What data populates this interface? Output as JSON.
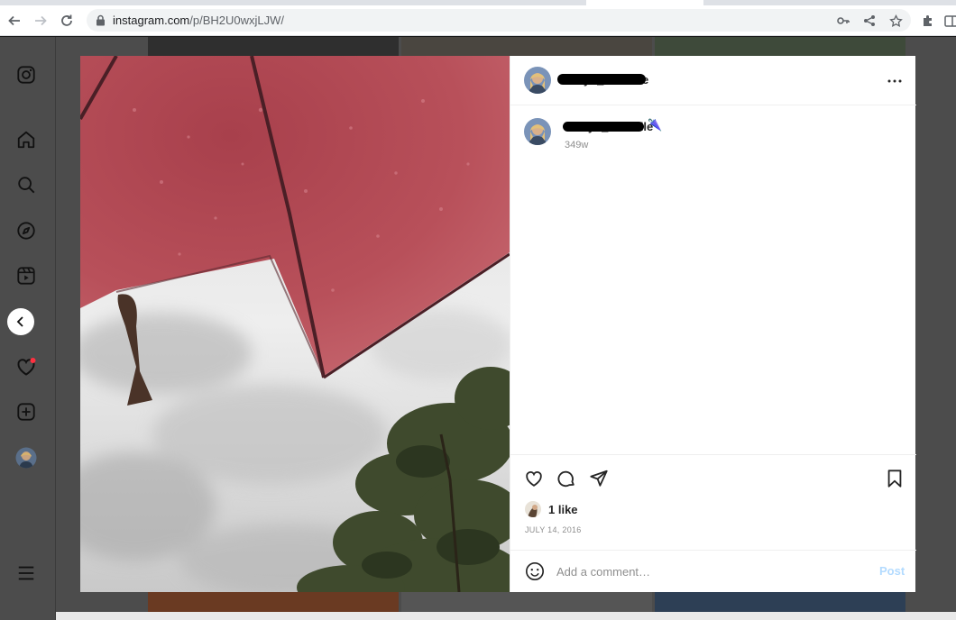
{
  "browser": {
    "url_host": "instagram.com",
    "url_path": "/p/BH2U0wxjLJW/"
  },
  "post": {
    "username": "kaitlyn_mcardle",
    "caption_emoji": "🌂",
    "time_ago": "349w",
    "likes": "1 like",
    "date": "JULY 14, 2016"
  },
  "comment": {
    "placeholder": "Add a comment…",
    "post_label": "Post"
  },
  "colors": {
    "accent_blue_disabled": "#b3dbff",
    "notification_red": "#ff3040",
    "umbrella_red": "#b24a55"
  },
  "icons": {
    "sidebar": [
      "instagram-logo-icon",
      "home-icon",
      "search-icon",
      "explore-icon",
      "reels-icon",
      "messages-icon",
      "notifications-icon",
      "create-icon",
      "profile-avatar",
      "menu-icon"
    ],
    "actions": [
      "heart-icon",
      "comment-icon",
      "share-icon",
      "bookmark-icon"
    ]
  }
}
